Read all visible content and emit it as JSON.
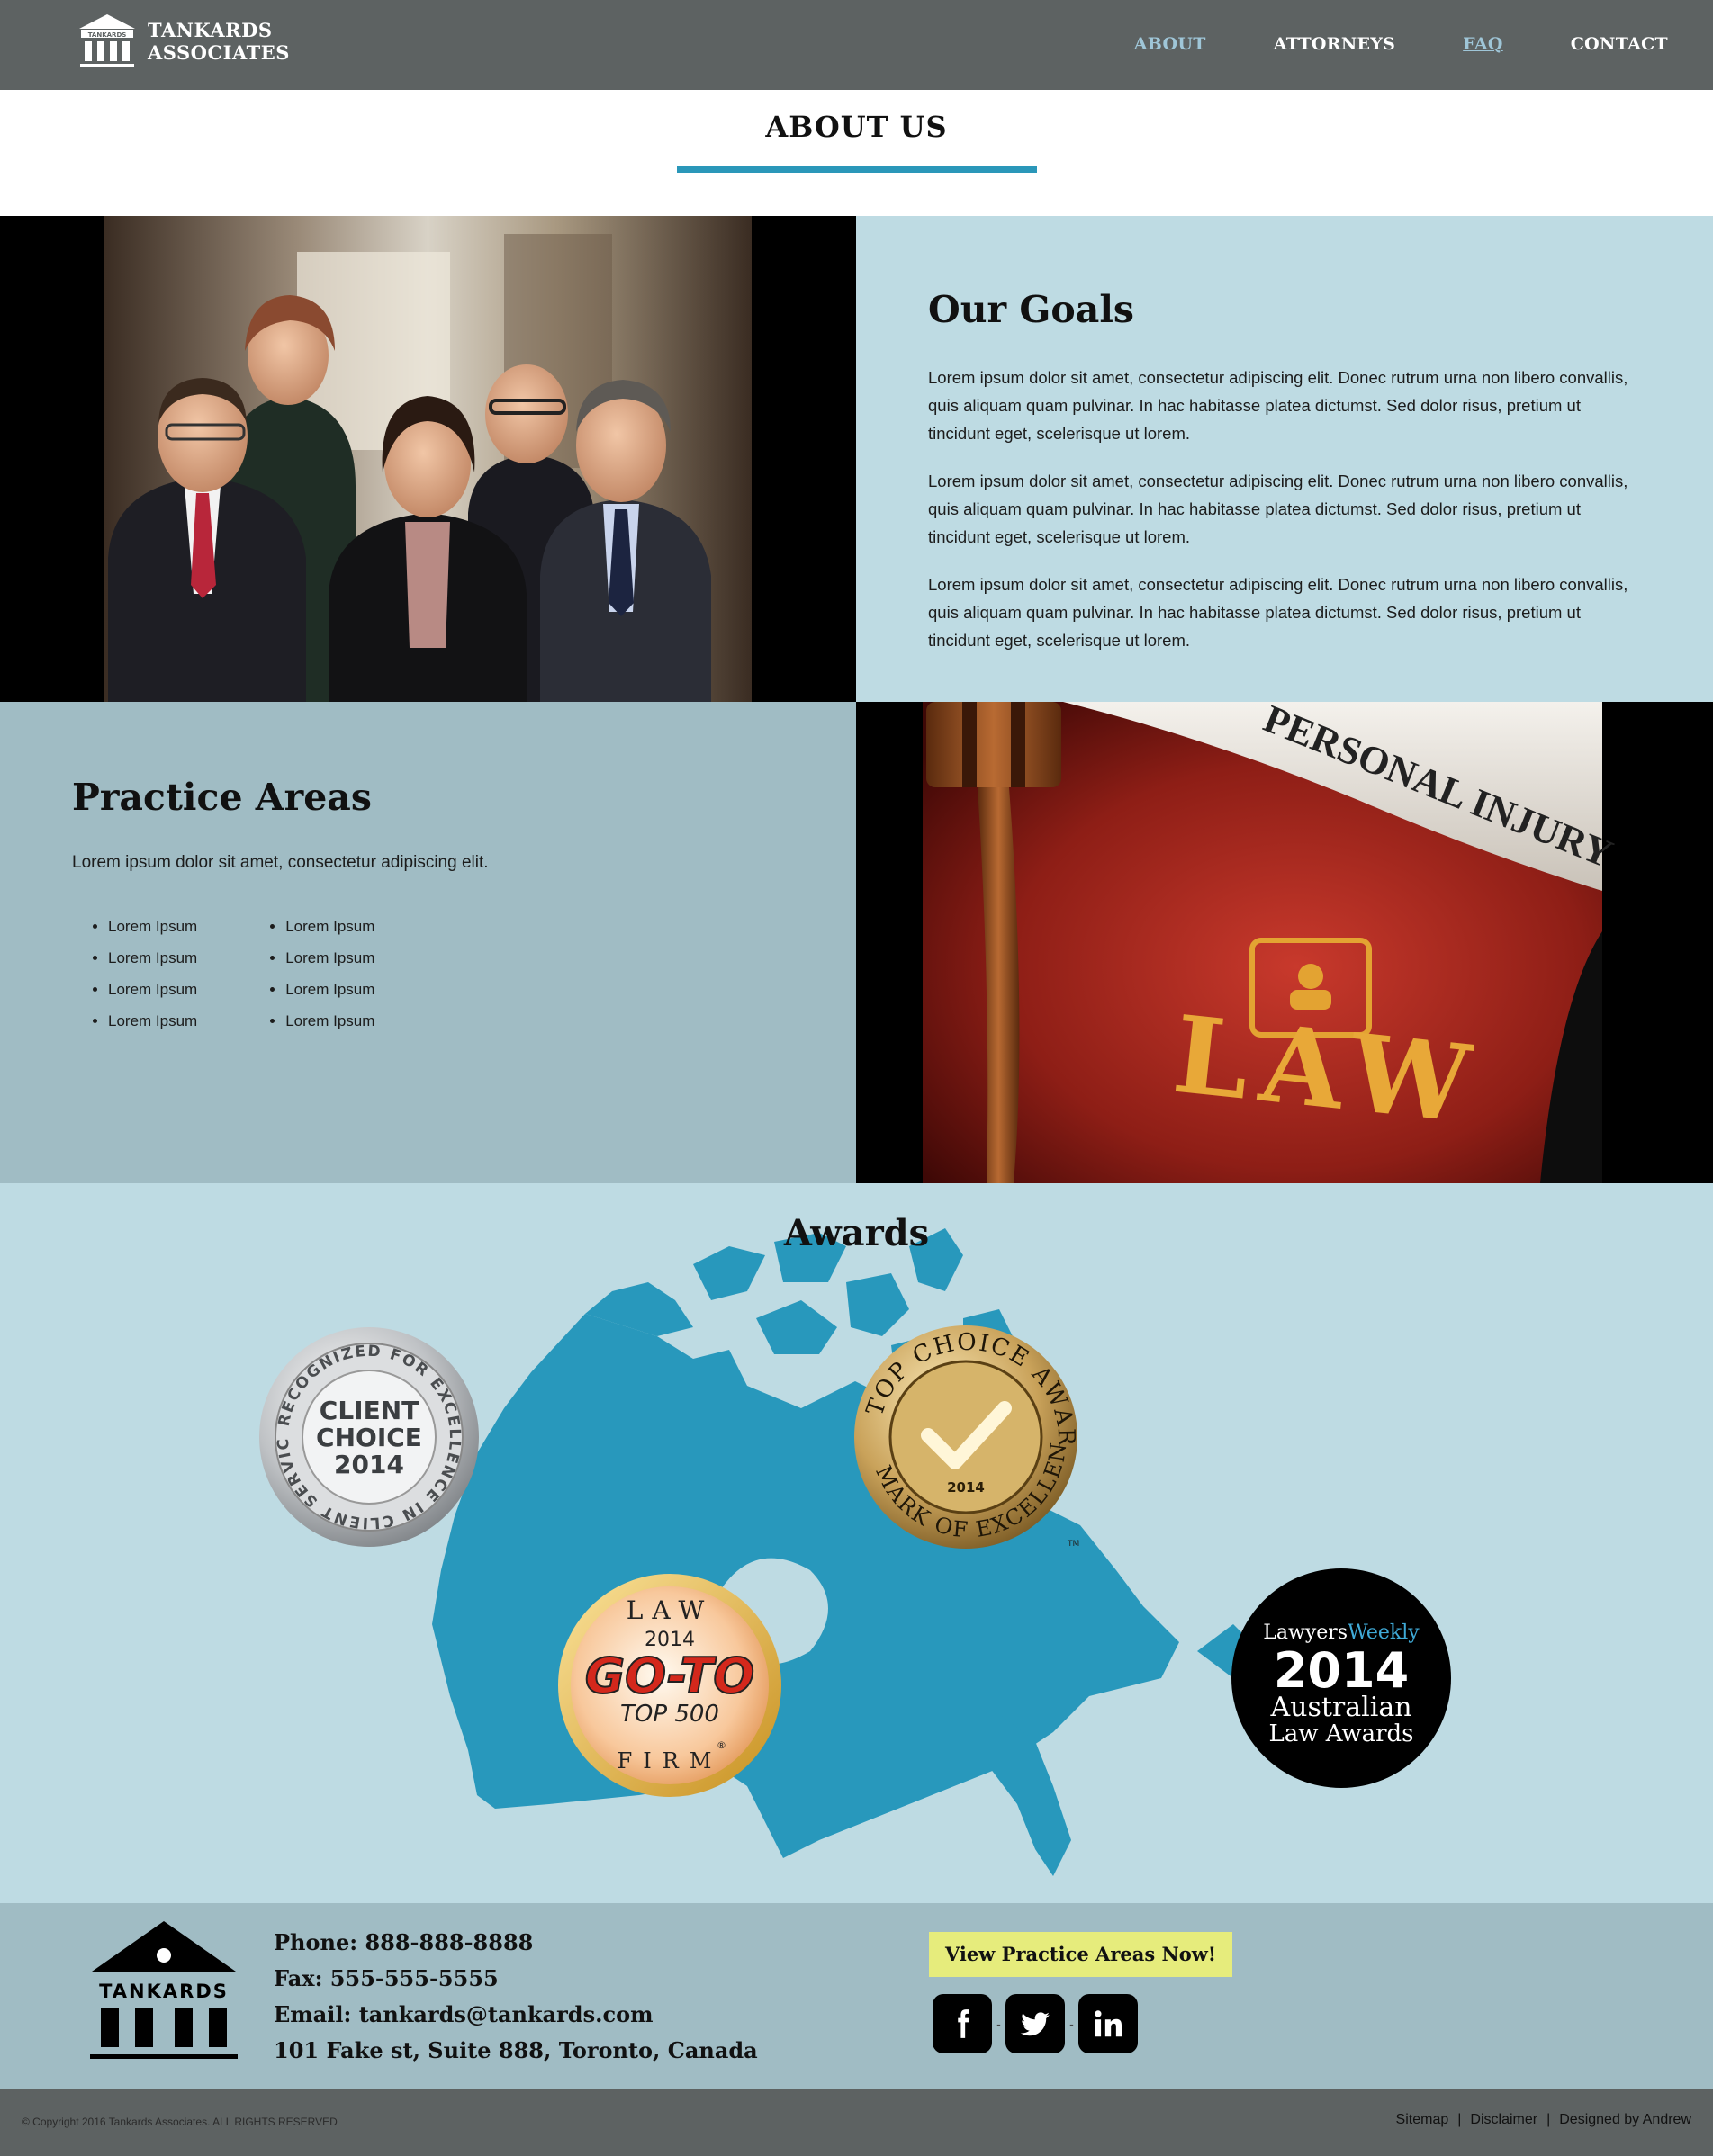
{
  "brand": {
    "name_line1": "TANKARDS",
    "name_line2": "ASSOCIATES",
    "mark_text": "TANKARDS"
  },
  "nav": {
    "items": [
      {
        "label": "ABOUT",
        "state": "active"
      },
      {
        "label": "ATTORNEYS",
        "state": "normal"
      },
      {
        "label": "FAQ",
        "state": "underlined"
      },
      {
        "label": "CONTACT",
        "state": "normal"
      }
    ]
  },
  "about": {
    "title": "ABOUT US"
  },
  "goals": {
    "heading": "Our Goals",
    "paragraphs": [
      "Lorem ipsum dolor sit amet, consectetur adipiscing elit. Donec rutrum urna non libero convallis, quis aliquam quam pulvinar. In hac habitasse platea dictumst. Sed dolor risus, pretium ut tincidunt eget, scelerisque ut lorem.",
      "Lorem ipsum dolor sit amet, consectetur adipiscing elit. Donec rutrum urna non libero convallis, quis aliquam quam pulvinar. In hac habitasse platea dictumst. Sed dolor risus, pretium ut tincidunt eget, scelerisque ut lorem.",
      "Lorem ipsum dolor sit amet, consectetur adipiscing elit. Donec rutrum urna non libero convallis, quis aliquam quam pulvinar. In hac habitasse platea dictumst. Sed dolor risus, pretium ut tincidunt eget, scelerisque ut lorem."
    ]
  },
  "practice": {
    "heading": "Practice Areas",
    "intro": "Lorem ipsum dolor sit amet, consectetur adipiscing elit.",
    "column1": [
      "Lorem Ipsum",
      "Lorem Ipsum",
      "Lorem Ipsum",
      "Lorem Ipsum"
    ],
    "column2": [
      "Lorem Ipsum",
      "Lorem Ipsum",
      "Lorem Ipsum",
      "Lorem Ipsum"
    ]
  },
  "law_photo": {
    "scroll_text": "PERSONAL INJURY",
    "book_text": "LAW"
  },
  "awards": {
    "heading": "Awards",
    "client_choice": {
      "ring_text": "RECOGNIZED FOR EXCELLENCE IN CLIENT SERVICE",
      "line1": "CLIENT",
      "line2": "CHOICE",
      "year": "2014"
    },
    "top_choice": {
      "ring_top": "TOP CHOICE AWARD",
      "ring_bottom": "MARK OF EXCELLENCE",
      "year": "2014",
      "tm": "TM"
    },
    "go_to": {
      "top": "LAW",
      "year": "2014",
      "main": "GO-TO",
      "sub": "TOP 500",
      "bottom": "FIRM",
      "reg": "®"
    },
    "lawyers_weekly": {
      "brand_a": "Lawyers",
      "brand_b": "Weekly",
      "year": "2014",
      "line1": "Australian",
      "line2": "Law Awards"
    }
  },
  "footer": {
    "phone": "Phone: 888-888-8888",
    "fax": "Fax: 555-555-5555",
    "email": "Email: tankards@tankards.com",
    "address": "101 Fake st, Suite 888, Toronto, Canada",
    "cta_label": "View Practice Areas Now!",
    "social_icons": [
      "facebook-icon",
      "twitter-icon",
      "linkedin-icon"
    ],
    "copyright": "© Copyright 2016 Tankards Associates. ALL RIGHTS RESERVED",
    "links": [
      "Sitemap",
      "Disclaimer",
      "Designed by Andrew"
    ],
    "separator": "|",
    "dash": "-"
  },
  "colors": {
    "header_bg": "#5d6262",
    "accent_blue": "#2a97b9",
    "light_blue_bg": "#bedbe3",
    "mid_blue_bg": "#a0bcc4",
    "cta_yellow": "#e6ec7c",
    "nav_active": "#9fc6d8"
  }
}
